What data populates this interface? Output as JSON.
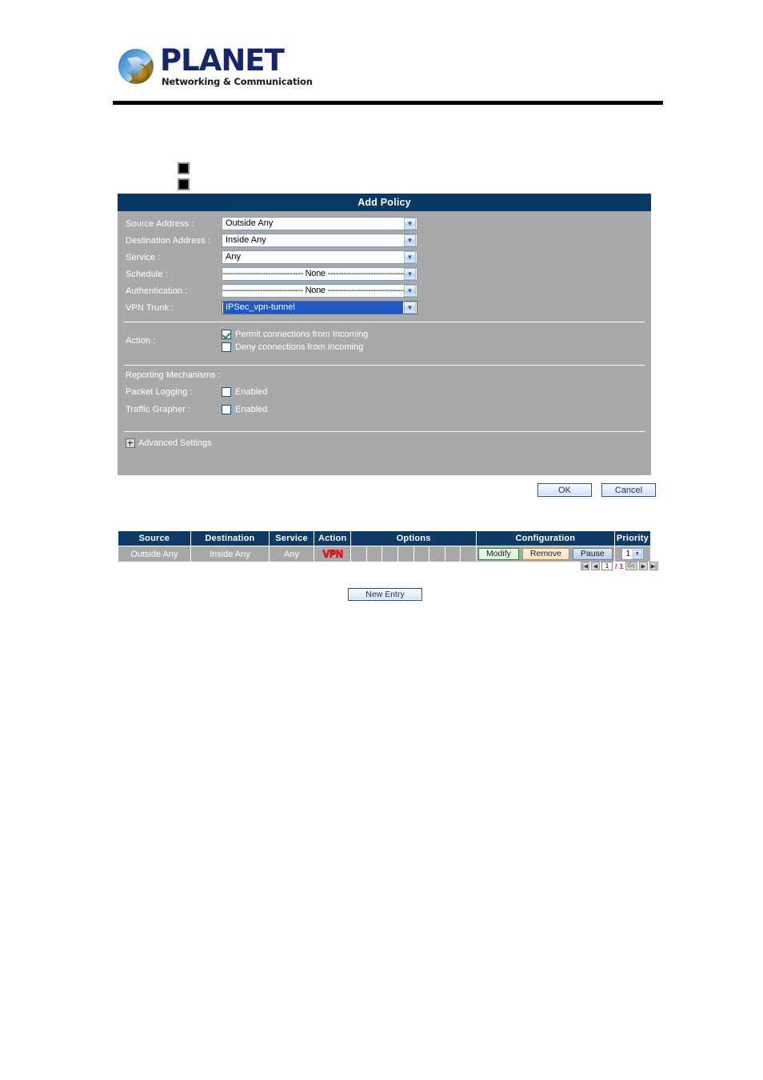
{
  "brand": {
    "wordmark": "PLANET",
    "tagline": "Networking & Communication"
  },
  "panel": {
    "title": "Add Policy",
    "fields": [
      {
        "label": "Source Address :",
        "value": "Outside Any",
        "centered": false,
        "highlighted": false
      },
      {
        "label": "Destination Address :",
        "value": "Inside Any",
        "centered": false,
        "highlighted": false
      },
      {
        "label": "Service :",
        "value": "Any",
        "centered": false,
        "highlighted": false
      },
      {
        "label": "Schedule :",
        "value": "------------------------------ None ------------------------------",
        "centered": true,
        "highlighted": false
      },
      {
        "label": "Authentication :",
        "value": "------------------------------ None ------------------------------",
        "centered": true,
        "highlighted": false
      },
      {
        "label": "VPN Trunk :",
        "value": "IPSec_vpn-tunnel",
        "centered": false,
        "highlighted": true
      }
    ],
    "action": {
      "label": "Action :",
      "permit_label": "Permit connections from Incoming",
      "permit_checked": true,
      "deny_label": "Deny connections from Incoming",
      "deny_checked": false
    },
    "reporting": {
      "title": "Reporting Mechanisms :",
      "packet_logging_label": "Packet Logging :",
      "packet_logging_value": "Enabled",
      "packet_logging_checked": false,
      "traffic_grapher_label": "Traffic Grapher :",
      "traffic_grapher_value": "Enabled",
      "traffic_grapher_checked": false
    },
    "advanced_label": "Advanced Settings"
  },
  "dialog_buttons": {
    "ok": "OK",
    "cancel": "Cancel"
  },
  "policy_table": {
    "headers": {
      "source": "Source",
      "destination": "Destination",
      "service": "Service",
      "action": "Action",
      "options": "Options",
      "configuration": "Configuration",
      "priority": "Priority"
    },
    "row": {
      "source": "Outside Any",
      "destination": "Inside Any",
      "service": "Any",
      "action_badge": "VPN",
      "options_cells": [
        "",
        "",
        "",
        "",
        "",
        "",
        "",
        ""
      ],
      "modify": "Modify",
      "remove": "Remove",
      "pause": "Pause",
      "priority_value": "1"
    }
  },
  "pagination": {
    "first": "|◀",
    "prev": "◀",
    "current_page": "1",
    "separator": "/",
    "total_pages": "1",
    "go": "Go",
    "next": "▶",
    "last": "▶|"
  },
  "footer": {
    "new_entry": "New Entry"
  },
  "colors": {
    "panel_header": "#083864",
    "panel_body": "#a9a9a9",
    "table_header": "#0d3b66",
    "vpn_badge": "#e01b1b",
    "highlight_select": "#2158c8"
  }
}
